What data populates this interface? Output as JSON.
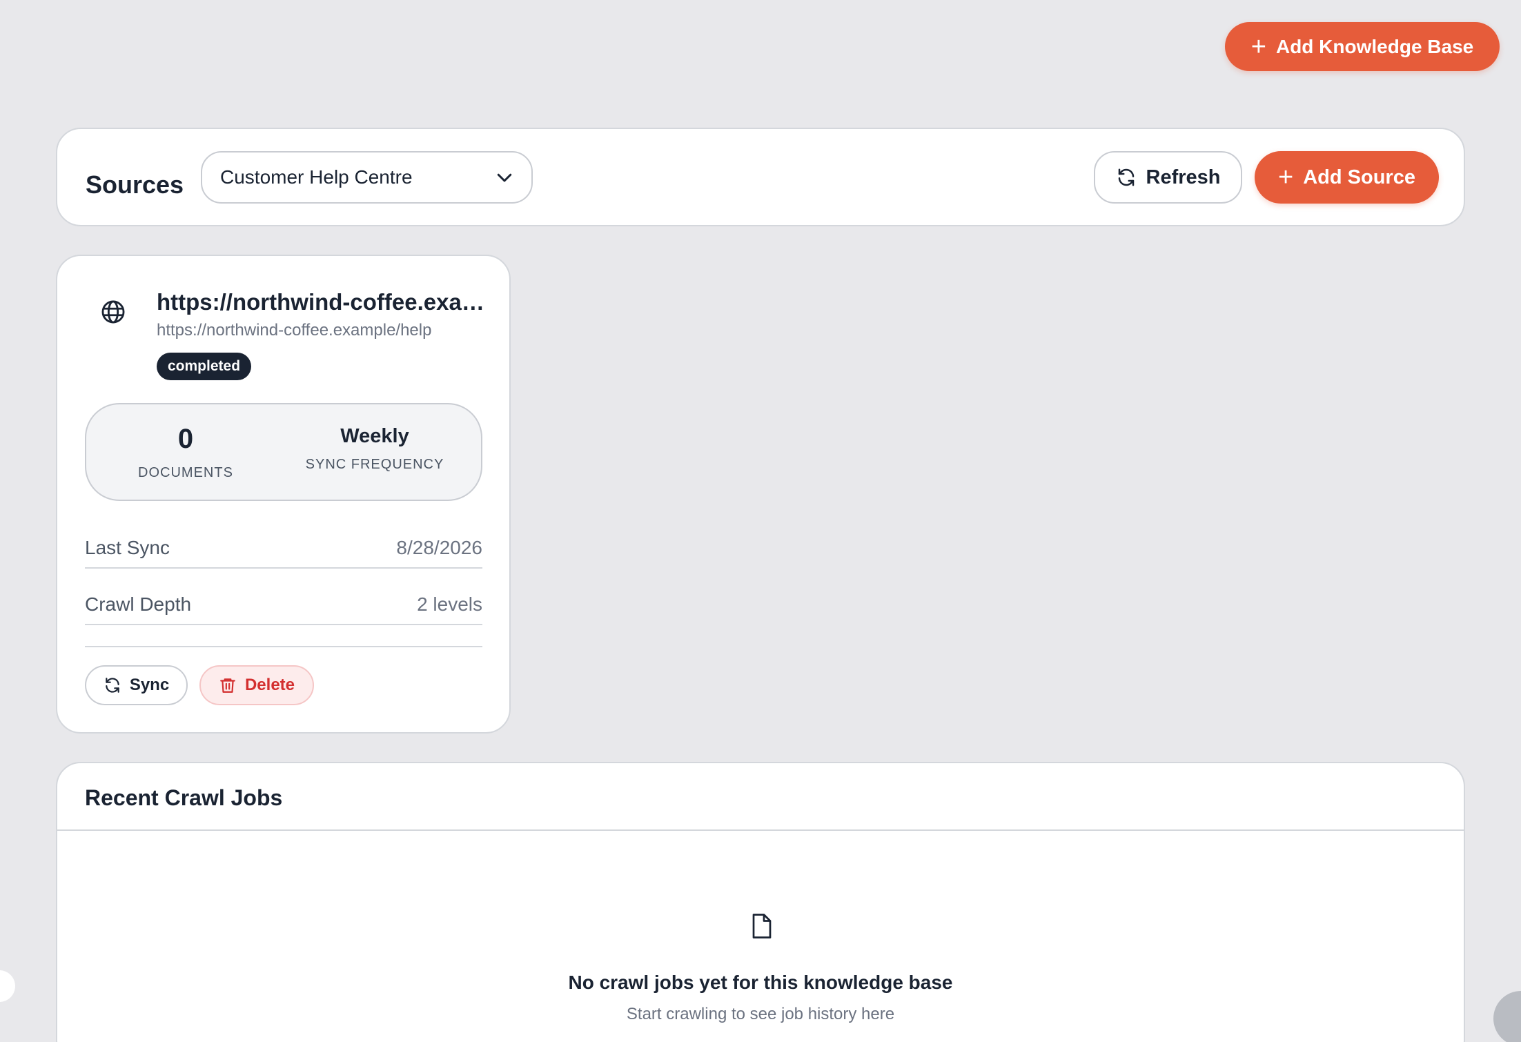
{
  "header": {
    "add_kb_label": "Add Knowledge Base"
  },
  "sources": {
    "title": "Sources",
    "selected_kb": "Customer Help Centre",
    "refresh_label": "Refresh",
    "add_source_label": "Add Source"
  },
  "source_card": {
    "title": "https://northwind-coffee.example/help",
    "url": "https://northwind-coffee.example/help",
    "status": "completed",
    "documents_value": "0",
    "documents_label": "DOCUMENTS",
    "sync_frequency_value": "Weekly",
    "sync_frequency_label": "SYNC FREQUENCY",
    "last_sync_label": "Last Sync",
    "last_sync_value": "8/28/2026",
    "crawl_depth_label": "Crawl Depth",
    "crawl_depth_value": "2 levels",
    "sync_label": "Sync",
    "delete_label": "Delete"
  },
  "crawl_jobs": {
    "title": "Recent Crawl Jobs",
    "empty_title": "No crawl jobs yet for this knowledge base",
    "empty_subtitle": "Start crawling to see job history here"
  },
  "colors": {
    "accent": "#e65c3a",
    "background": "#e8e8eb",
    "status_badge": "#1a2332",
    "danger": "#d32f2f"
  }
}
